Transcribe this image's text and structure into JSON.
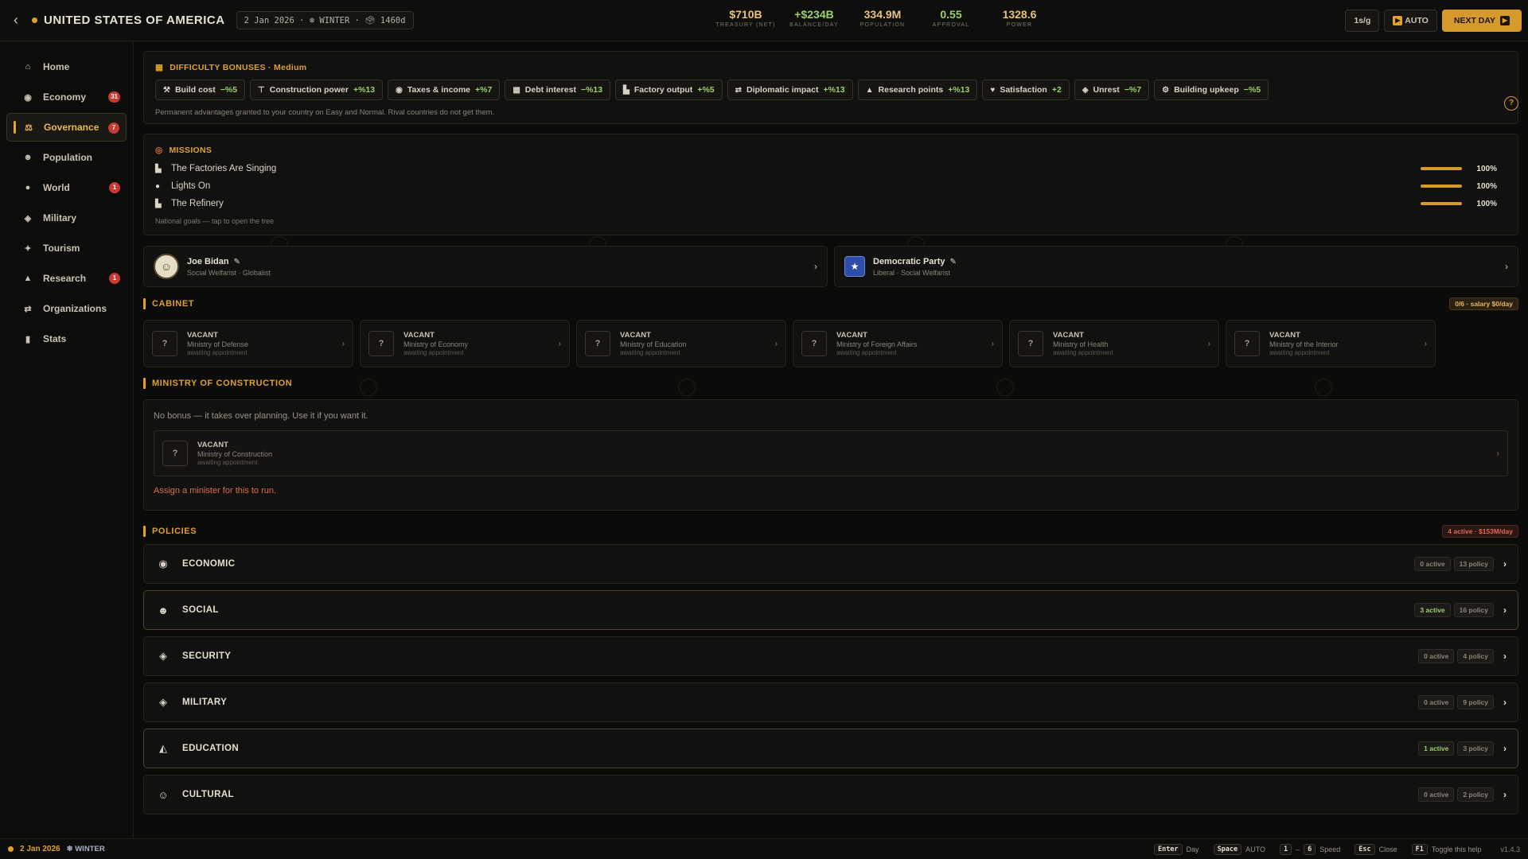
{
  "topbar": {
    "country": "UNITED STATES OF AMERICA",
    "date_chip": "2 Jan 2026 · ❄ WINTER · 🗳 1460d",
    "stats": [
      {
        "value": "$710B",
        "label": "TREASURY (NET)",
        "color": "#e8c27a"
      },
      {
        "value": "+$234B",
        "label": "BALANCE/DAY",
        "color": "#9ccf6a"
      },
      {
        "value": "334.9M",
        "label": "POPULATION",
        "color": "#e8c27a"
      },
      {
        "value": "0.55",
        "label": "APPROVAL",
        "color": "#9ccf6a"
      },
      {
        "value": "1328.6",
        "label": "POWER",
        "color": "#e8c27a"
      }
    ],
    "speed_label": "1s/g",
    "auto_label": "AUTO",
    "next_day_label": "NEXT DAY"
  },
  "sidebar": {
    "items": [
      {
        "label": "Home",
        "icon": "home-icon",
        "glyph": "⌂",
        "badge": ""
      },
      {
        "label": "Economy",
        "icon": "coins-icon",
        "glyph": "◉",
        "badge": "31"
      },
      {
        "label": "Governance",
        "icon": "scales-icon",
        "glyph": "⚖",
        "badge": "7"
      },
      {
        "label": "Population",
        "icon": "people-icon",
        "glyph": "☻",
        "badge": ""
      },
      {
        "label": "World",
        "icon": "globe-icon",
        "glyph": "●",
        "badge": "1"
      },
      {
        "label": "Military",
        "icon": "shield-icon",
        "glyph": "◈",
        "badge": ""
      },
      {
        "label": "Tourism",
        "icon": "palm-icon",
        "glyph": "✦",
        "badge": ""
      },
      {
        "label": "Research",
        "icon": "flask-icon",
        "glyph": "▲",
        "badge": "1"
      },
      {
        "label": "Organizations",
        "icon": "handshake-icon",
        "glyph": "⇄",
        "badge": ""
      },
      {
        "label": "Stats",
        "icon": "bar-chart-icon",
        "glyph": "▮",
        "badge": ""
      }
    ],
    "active": "Governance"
  },
  "difficulty": {
    "title": "DIFFICULTY BONUSES · Medium",
    "chips": [
      {
        "name": "Build cost",
        "value": "−%5",
        "icon": "hammer-icon",
        "glyph": "⚒"
      },
      {
        "name": "Construction power",
        "value": "+%13",
        "icon": "crane-icon",
        "glyph": "⊤"
      },
      {
        "name": "Taxes & income",
        "value": "+%7",
        "icon": "coins-icon",
        "glyph": "◉"
      },
      {
        "name": "Debt interest",
        "value": "−%13",
        "icon": "bank-icon",
        "glyph": "▦"
      },
      {
        "name": "Factory output",
        "value": "+%5",
        "icon": "factory-icon",
        "glyph": "▙"
      },
      {
        "name": "Diplomatic impact",
        "value": "+%13",
        "icon": "handshake-icon",
        "glyph": "⇄"
      },
      {
        "name": "Research points",
        "value": "+%13",
        "icon": "flask-icon",
        "glyph": "▲"
      },
      {
        "name": "Satisfaction",
        "value": "+2",
        "icon": "heart-icon",
        "glyph": "♥"
      },
      {
        "name": "Unrest",
        "value": "−%7",
        "icon": "shield-icon",
        "glyph": "◈"
      },
      {
        "name": "Building upkeep",
        "value": "−%5",
        "icon": "gear-icon",
        "glyph": "⚙"
      }
    ],
    "note": "Permanent advantages granted to your country on Easy and Normal. Rival countries do not get them."
  },
  "missions": {
    "title": "MISSIONS",
    "items": [
      {
        "name": "The Factories Are Singing",
        "progress": 100,
        "pct_label": "100%",
        "icon": "factory-icon",
        "glyph": "▙"
      },
      {
        "name": "Lights On",
        "progress": 100,
        "pct_label": "100%",
        "icon": "bulb-icon",
        "glyph": "●"
      },
      {
        "name": "The Refinery",
        "progress": 100,
        "pct_label": "100%",
        "icon": "factory-icon",
        "glyph": "▙"
      }
    ],
    "note": "National goals — tap to open the tree"
  },
  "leader": {
    "name": "Joe Bidan",
    "sub": "Social Welfarist · Globalist"
  },
  "party": {
    "name": "Democratic Party",
    "sub": "Liberal · Social Welfarist"
  },
  "cabinet": {
    "title": "CABINET",
    "pill": "0/6 · salary $0/day",
    "members": [
      {
        "status": "VACANT",
        "role": "Ministry of Defense",
        "note": "awaiting appointment"
      },
      {
        "status": "VACANT",
        "role": "Ministry of Economy",
        "note": "awaiting appointment"
      },
      {
        "status": "VACANT",
        "role": "Ministry of Education",
        "note": "awaiting appointment"
      },
      {
        "status": "VACANT",
        "role": "Ministry of Foreign Affairs",
        "note": "awaiting appointment"
      },
      {
        "status": "VACANT",
        "role": "Ministry of Health",
        "note": "awaiting appointment"
      },
      {
        "status": "VACANT",
        "role": "Ministry of the Interior",
        "note": "awaiting appointment"
      }
    ]
  },
  "construction": {
    "title": "MINISTRY OF CONSTRUCTION",
    "note": "No bonus — it takes over planning. Use it if you want it.",
    "status": "VACANT",
    "role": "Ministry of Construction",
    "await": "awaiting appointment",
    "warning": "Assign a minister for this to run."
  },
  "policies": {
    "title": "POLICIES",
    "pill": "4 active · $153M/day",
    "rows": [
      {
        "name": "ECONOMIC",
        "active": "0 active",
        "count": "13 policy",
        "on": false,
        "icon": "coins-icon",
        "glyph": "◉"
      },
      {
        "name": "SOCIAL",
        "active": "3 active",
        "count": "16 policy",
        "on": true,
        "icon": "people-icon",
        "glyph": "☻"
      },
      {
        "name": "SECURITY",
        "active": "0 active",
        "count": "4 policy",
        "on": false,
        "icon": "shield-icon",
        "glyph": "◈"
      },
      {
        "name": "MILITARY",
        "active": "0 active",
        "count": "9 policy",
        "on": false,
        "icon": "shield-icon",
        "glyph": "◈"
      },
      {
        "name": "EDUCATION",
        "active": "1 active",
        "count": "3 policy",
        "on": true,
        "icon": "graduation-cap-icon",
        "glyph": "◭"
      },
      {
        "name": "CULTURAL",
        "active": "0 active",
        "count": "2 policy",
        "on": false,
        "icon": "masks-icon",
        "glyph": "☺"
      }
    ]
  },
  "bottombar": {
    "date": "2 Jan 2026",
    "season": "❄ WINTER",
    "shortcuts": [
      {
        "key": "Enter",
        "desc": "Day"
      },
      {
        "key": "Space",
        "desc": "AUTO"
      },
      {
        "key": "1",
        "desc": ""
      },
      {
        "key": "6",
        "desc": "Speed"
      },
      {
        "key": "Esc",
        "desc": "Close"
      },
      {
        "key": "F1",
        "desc": "Toggle this help"
      }
    ],
    "range_sep": "–",
    "version": "v1.4.3"
  },
  "colors": {
    "accent": "#e0a02a",
    "positive": "#9ccf6a",
    "danger": "#c9392f"
  }
}
